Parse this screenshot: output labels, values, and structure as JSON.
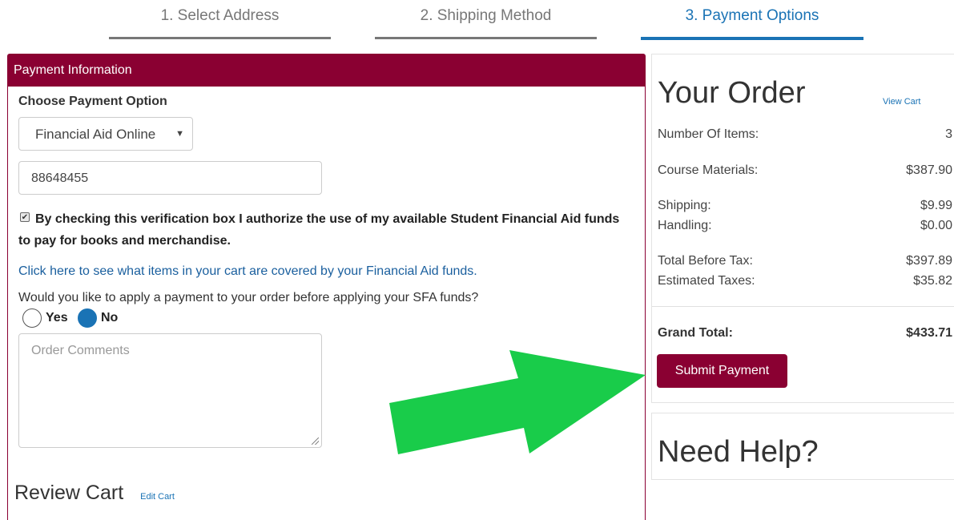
{
  "steps": [
    {
      "label": "1. Select Address"
    },
    {
      "label": "2. Shipping Method"
    },
    {
      "label": "3. Payment Options"
    }
  ],
  "payment": {
    "header": "Payment Information",
    "choose_label": "Choose Payment Option",
    "selected_option": "Financial Aid Online",
    "account_number": "88648455",
    "verification_text": "By checking this verification box I authorize the use of my available Student Financial Aid funds to pay for books and merchandise.",
    "coverage_link": "Click here to see what items in your cart are covered by your Financial Aid funds.",
    "question": "Would you like to apply a payment to your order before applying your SFA funds?",
    "yes_label": "Yes",
    "no_label": "No",
    "comments_placeholder": "Order Comments",
    "review_title": "Review Cart",
    "edit_cart_link": "Edit Cart"
  },
  "order": {
    "title": "Your Order",
    "view_cart_link": "View Cart",
    "rows": {
      "items": {
        "label": "Number Of Items:",
        "value": "3"
      },
      "materials": {
        "label": "Course Materials:",
        "value": "$387.90"
      },
      "shipping": {
        "label": "Shipping:",
        "value": "$9.99"
      },
      "handling": {
        "label": "Handling:",
        "value": "$0.00"
      },
      "before_tax": {
        "label": "Total Before Tax:",
        "value": "$397.89"
      },
      "taxes": {
        "label": "Estimated Taxes:",
        "value": "$35.82"
      },
      "grand_total": {
        "label": "Grand Total:",
        "value": "$433.71"
      }
    },
    "submit_label": "Submit Payment"
  },
  "help": {
    "title": "Need Help?"
  },
  "colors": {
    "brand": "#8a0032",
    "accent": "#1a73b5",
    "arrow": "#19cc4a"
  }
}
